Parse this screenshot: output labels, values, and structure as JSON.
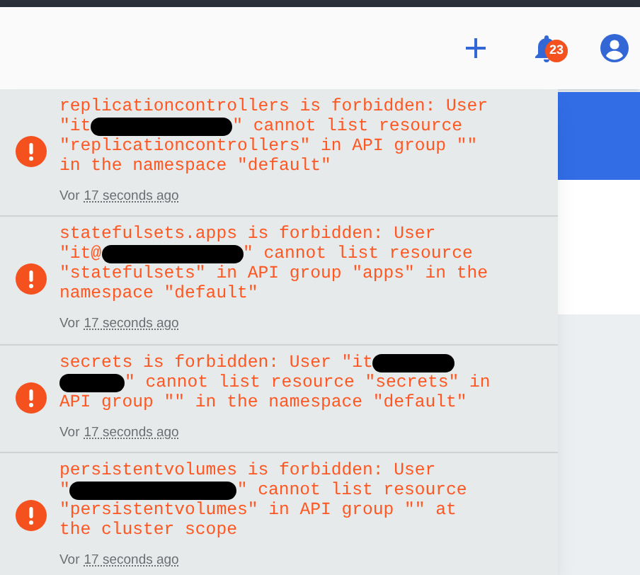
{
  "toolbar": {
    "notification_count": "23"
  },
  "notifications": [
    {
      "parts": [
        {
          "kind": "text",
          "text": "replicationcontrollers is forbidden: User \"it"
        },
        {
          "kind": "redacted"
        },
        {
          "kind": "text",
          "text": "\" cannot list resource \"replicationcontrollers\" in API group \"\" in the namespace \"default\""
        }
      ],
      "prefix": "Vor",
      "time": "17 seconds ago"
    },
    {
      "parts": [
        {
          "kind": "text",
          "text": "statefulsets.apps is forbidden: User \"it@"
        },
        {
          "kind": "redacted"
        },
        {
          "kind": "text",
          "text": "\" cannot list resource \"statefulsets\" in API group \"apps\" in the namespace \"default\""
        }
      ],
      "prefix": "Vor",
      "time": "17 seconds ago"
    },
    {
      "parts": [
        {
          "kind": "text",
          "text": "secrets is forbidden: User \"it"
        },
        {
          "kind": "redacted_split"
        },
        {
          "kind": "text",
          "text": "\" cannot list resource \"secrets\" in API group \"\" in the namespace \"default\""
        }
      ],
      "prefix": "Vor",
      "time": "17 seconds ago"
    },
    {
      "parts": [
        {
          "kind": "text",
          "text": "persistentvolumes is forbidden: User \""
        },
        {
          "kind": "redacted_wide"
        },
        {
          "kind": "text",
          "text": "\" cannot list resource \"persistentvolumes\" in API group \"\" at the cluster scope"
        }
      ],
      "prefix": "Vor",
      "time": "17 seconds ago"
    }
  ]
}
